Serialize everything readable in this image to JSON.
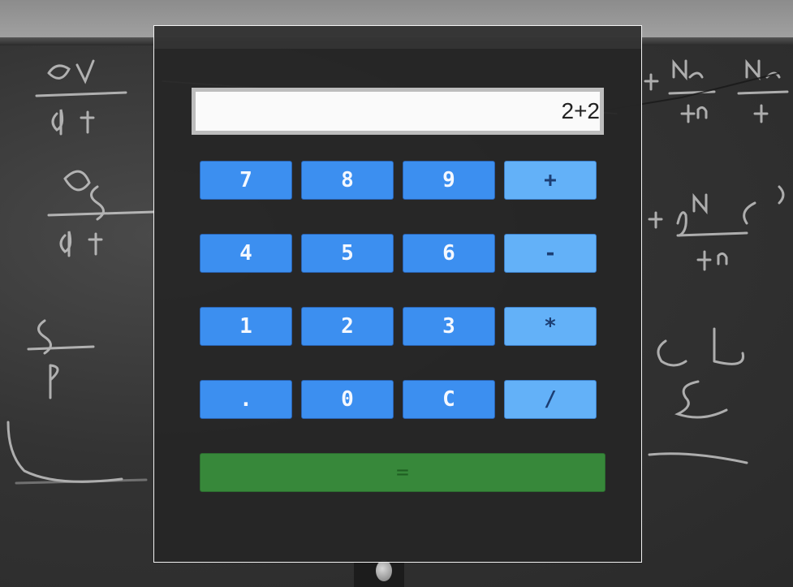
{
  "display": {
    "value": "2+2"
  },
  "keypad": {
    "rows": [
      [
        {
          "label": "7",
          "name": "key-7"
        },
        {
          "label": "8",
          "name": "key-8"
        },
        {
          "label": "9",
          "name": "key-9"
        },
        {
          "label": "+",
          "name": "key-plus"
        }
      ],
      [
        {
          "label": "4",
          "name": "key-4"
        },
        {
          "label": "5",
          "name": "key-5"
        },
        {
          "label": "6",
          "name": "key-6"
        },
        {
          "label": "-",
          "name": "key-minus"
        }
      ],
      [
        {
          "label": "1",
          "name": "key-1"
        },
        {
          "label": "2",
          "name": "key-2"
        },
        {
          "label": "3",
          "name": "key-3"
        },
        {
          "label": "*",
          "name": "key-multiply"
        }
      ],
      [
        {
          "label": ".",
          "name": "key-decimal"
        },
        {
          "label": "0",
          "name": "key-0"
        },
        {
          "label": "C",
          "name": "key-clear"
        },
        {
          "label": "/",
          "name": "key-divide"
        }
      ]
    ],
    "equals": {
      "label": "=",
      "name": "key-equals"
    }
  },
  "colors": {
    "number_key": "#3c8ff0",
    "operator_key": "#63b1f8",
    "equals_key": "#37883a",
    "display_background": "#fafafa"
  }
}
